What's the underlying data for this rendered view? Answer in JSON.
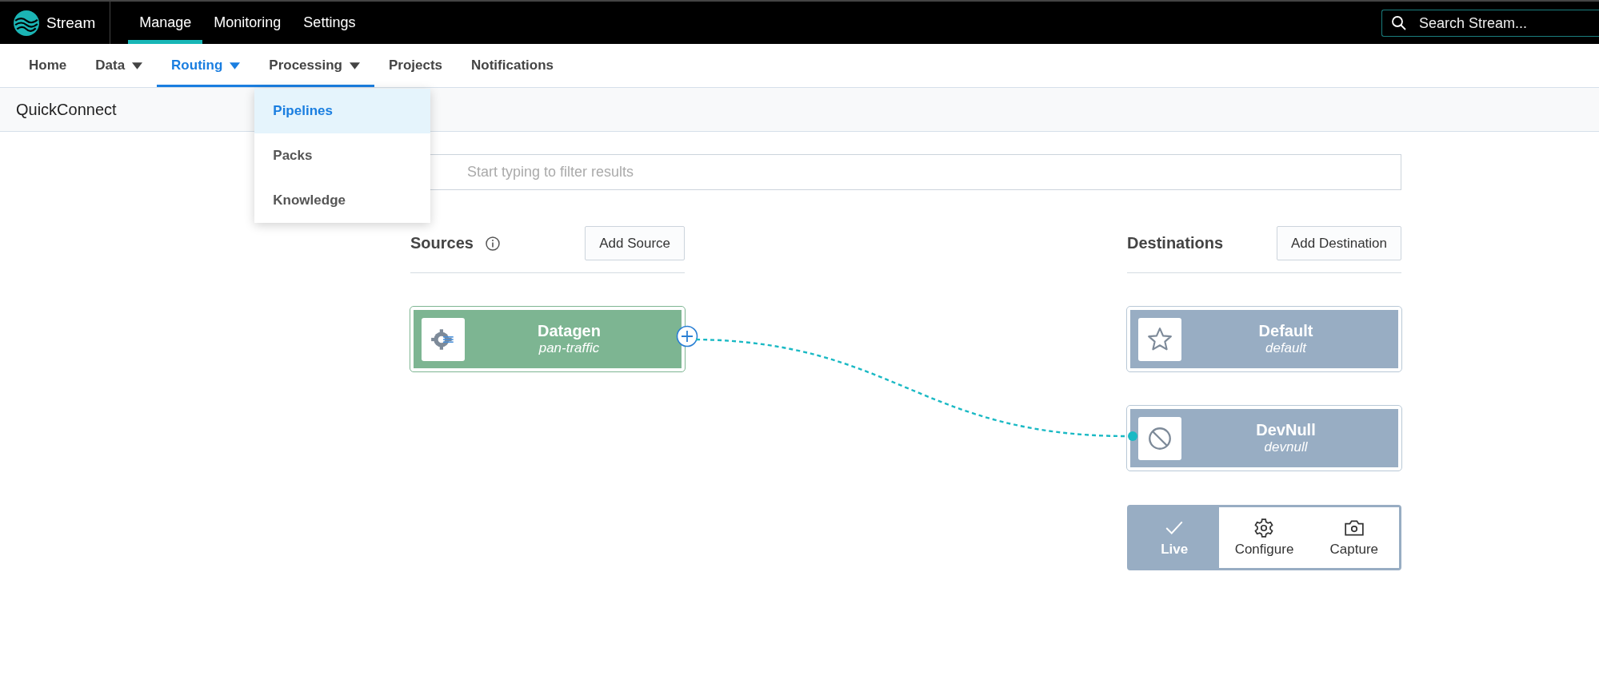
{
  "top_bar": {
    "brand": "Stream",
    "tabs": [
      {
        "label": "Manage",
        "selected": true
      },
      {
        "label": "Monitoring",
        "selected": false
      },
      {
        "label": "Settings",
        "selected": false
      }
    ],
    "search": {
      "placeholder": "Search Stream..."
    }
  },
  "nav": {
    "items": [
      {
        "label": "Home",
        "selected": false,
        "has_menu": false,
        "expanded": false
      },
      {
        "label": "Data",
        "selected": false,
        "has_menu": true,
        "expanded": false
      },
      {
        "label": "Routing",
        "selected": true,
        "has_menu": true,
        "expanded": false
      },
      {
        "label": "Processing",
        "selected": false,
        "has_menu": true,
        "expanded": true
      },
      {
        "label": "Projects",
        "selected": false,
        "has_menu": false,
        "expanded": false
      },
      {
        "label": "Notifications",
        "selected": false,
        "has_menu": false,
        "expanded": false
      }
    ]
  },
  "menu": {
    "items": [
      {
        "label": "Pipelines",
        "selected": true
      },
      {
        "label": "Packs",
        "selected": false
      },
      {
        "label": "Knowledge",
        "selected": false
      }
    ]
  },
  "page_title": "QuickConnect",
  "filter": {
    "placeholder": "Start typing to filter results"
  },
  "sources": {
    "title": "Sources",
    "button": "Add Source",
    "items": [
      {
        "name": "Datagen",
        "subtitle": "pan-traffic",
        "kind": "datagen"
      }
    ]
  },
  "destinations": {
    "title": "Destinations",
    "button": "Add Destination",
    "items": [
      {
        "name": "Default",
        "subtitle": "default",
        "kind": "default"
      },
      {
        "name": "DevNull",
        "subtitle": "devnull",
        "kind": "devnull"
      }
    ]
  },
  "actions": [
    {
      "label": "Live",
      "kind": "live",
      "selected": true
    },
    {
      "label": "Configure",
      "kind": "configure",
      "selected": false
    },
    {
      "label": "Capture",
      "kind": "capture",
      "selected": false
    }
  ]
}
